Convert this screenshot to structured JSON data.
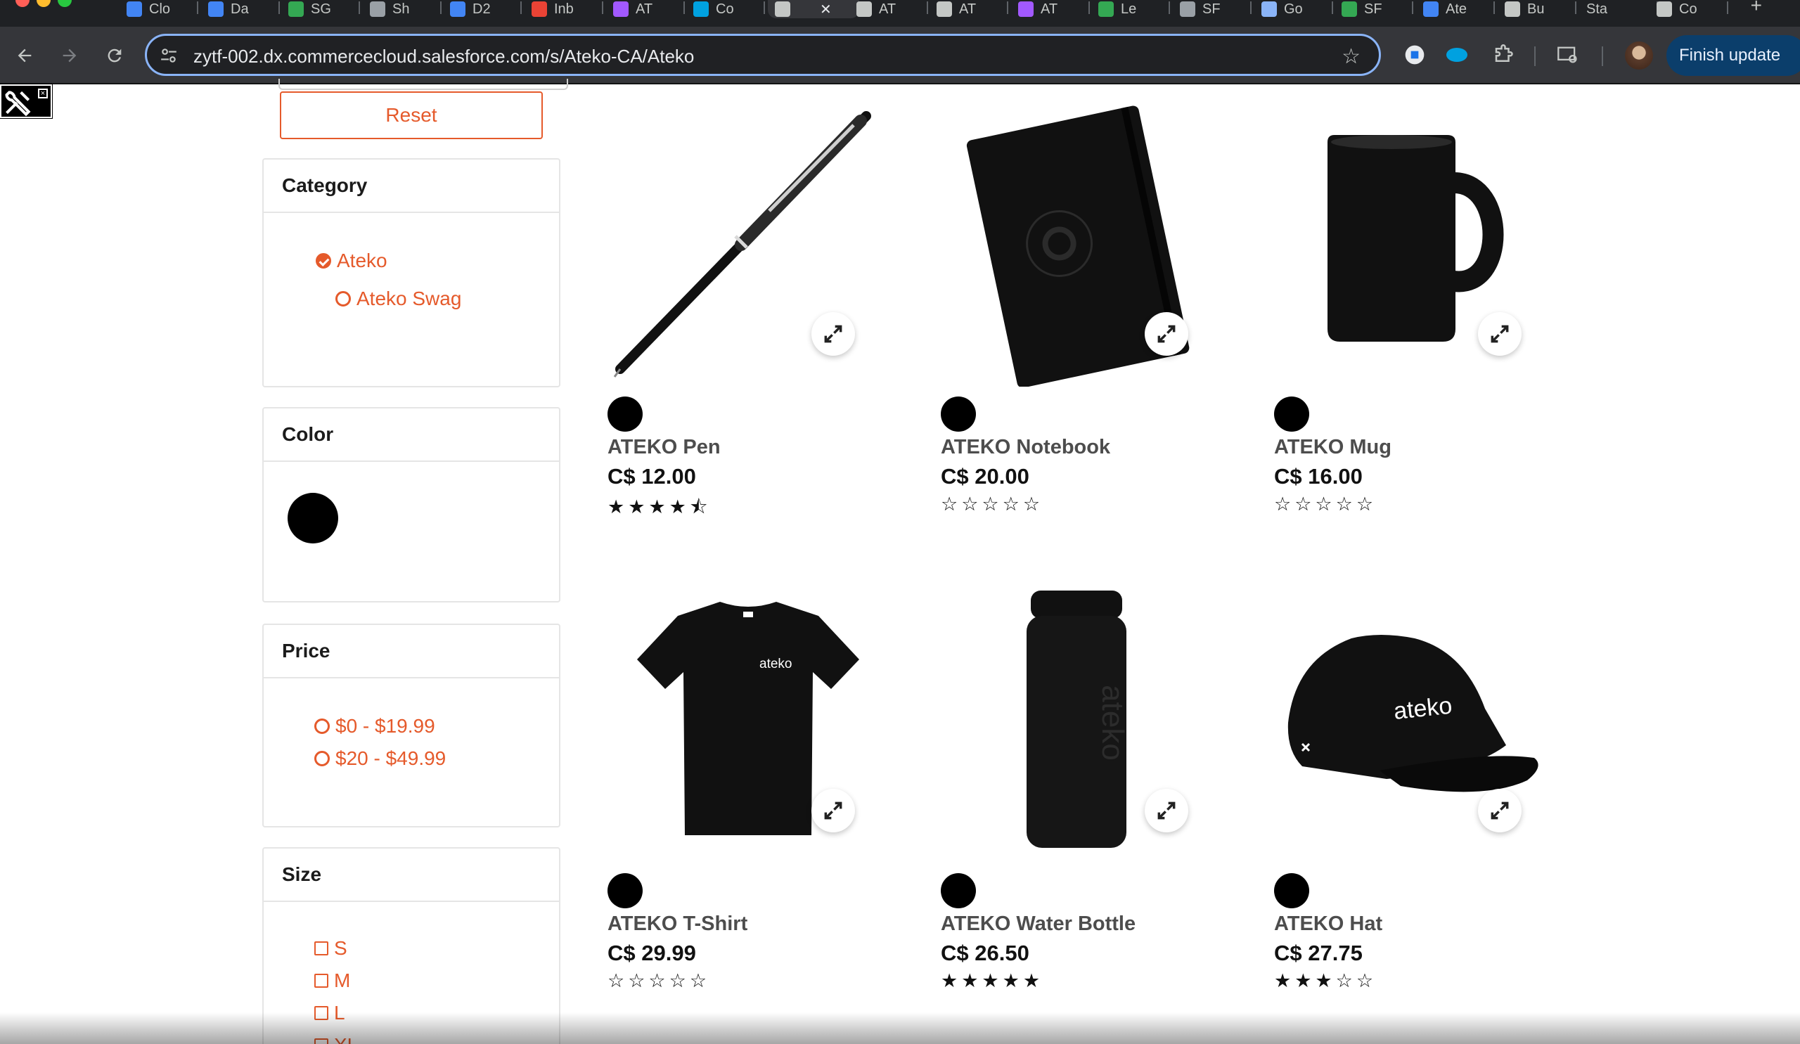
{
  "browser": {
    "tabs": [
      {
        "label": "Clo",
        "icon": "calendar-icon",
        "color": "#4285f4"
      },
      {
        "label": "Da",
        "icon": "docs-icon",
        "color": "#4285f4"
      },
      {
        "label": "SG",
        "icon": "sheets-icon",
        "color": "#34a853"
      },
      {
        "label": "Sh",
        "icon": "globe-icon",
        "color": "#9aa0a6"
      },
      {
        "label": "D2",
        "icon": "docs-icon",
        "color": "#4285f4"
      },
      {
        "label": "Inb",
        "icon": "gmail-icon",
        "color": "#ea4335"
      },
      {
        "label": "AT",
        "icon": "figma-icon",
        "color": "#a259ff"
      },
      {
        "label": "Co",
        "icon": "salesforce-icon",
        "color": "#00a1e0"
      },
      {
        "label": "",
        "icon": "github-icon",
        "color": "#c4c7c5"
      },
      {
        "label": "AT",
        "icon": "github-icon",
        "color": "#c4c7c5"
      },
      {
        "label": "AT",
        "icon": "github-icon",
        "color": "#c4c7c5"
      },
      {
        "label": "AT",
        "icon": "figma-icon",
        "color": "#a259ff"
      },
      {
        "label": "Le",
        "icon": "sheets-icon",
        "color": "#34a853"
      },
      {
        "label": "SF",
        "icon": "globe-icon",
        "color": "#9aa0a6"
      },
      {
        "label": "Go",
        "icon": "gemini-icon",
        "color": "#8ab4f8"
      },
      {
        "label": "SF",
        "icon": "sheets-icon",
        "color": "#34a853"
      },
      {
        "label": "Ate",
        "icon": "docs-icon",
        "color": "#4285f4"
      },
      {
        "label": "Bu",
        "icon": "github-icon",
        "color": "#c4c7c5"
      },
      {
        "label": "Sta",
        "icon": "",
        "color": "#c4c7c5"
      },
      {
        "label": "Co",
        "icon": "github-icon",
        "color": "#c4c7c5"
      }
    ],
    "url": "zytf-002.dx.commercecloud.salesforce.com/s/Ateko-CA/Ateko",
    "finish_update": "Finish update"
  },
  "filters": {
    "reset_label": "Reset",
    "category": {
      "title": "Category",
      "options": [
        {
          "label": "Ateko",
          "selected": true
        },
        {
          "label": "Ateko Swag",
          "selected": false
        }
      ]
    },
    "color": {
      "title": "Color",
      "swatch": "#000000"
    },
    "price": {
      "title": "Price",
      "options": [
        {
          "label": "$0 - $19.99",
          "selected": false
        },
        {
          "label": "$20 - $49.99",
          "selected": false
        }
      ]
    },
    "size": {
      "title": "Size",
      "options": [
        "S",
        "M",
        "L",
        "XL"
      ]
    }
  },
  "accent_color": "#e55a2b",
  "products": [
    {
      "name": "ATEKO Pen",
      "price": "C$ 12.00",
      "rating": 4.5,
      "stars": "★★★★⯪",
      "swatch": "#000000",
      "image": "pen"
    },
    {
      "name": "ATEKO Notebook",
      "price": "C$ 20.00",
      "rating": 0,
      "stars": "☆☆☆☆☆",
      "swatch": "#000000",
      "image": "notebook"
    },
    {
      "name": "ATEKO Mug",
      "price": "C$ 16.00",
      "rating": 0,
      "stars": "☆☆☆☆☆",
      "swatch": "#000000",
      "image": "mug"
    },
    {
      "name": "ATEKO T-Shirt",
      "price": "C$ 29.99",
      "rating": 0,
      "stars": "☆☆☆☆☆",
      "swatch": "#000000",
      "image": "tshirt",
      "print": "ateko"
    },
    {
      "name": "ATEKO Water Bottle",
      "price": "C$ 26.50",
      "rating": 5,
      "stars": "★★★★★",
      "swatch": "#000000",
      "image": "bottle",
      "print": "ateko"
    },
    {
      "name": "ATEKO Hat",
      "price": "C$ 27.75",
      "rating": 3,
      "stars": "★★★☆☆",
      "swatch": "#000000",
      "image": "hat",
      "print": "ateko"
    }
  ]
}
